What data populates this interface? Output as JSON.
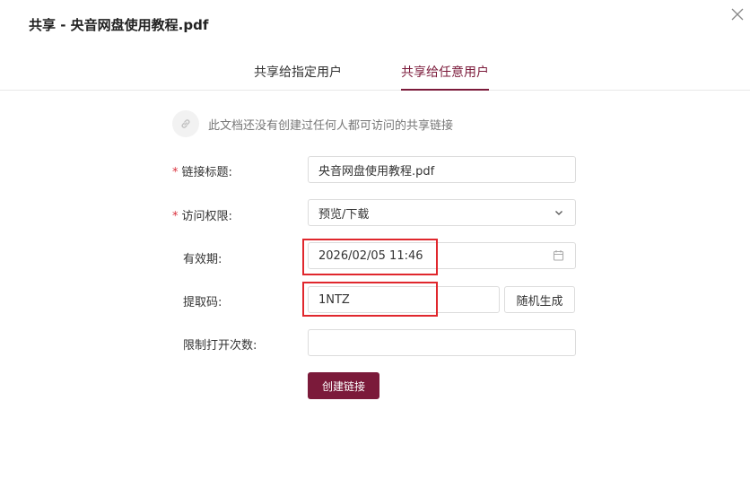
{
  "dialog": {
    "title": "共享 - 央音网盘使用教程.pdf"
  },
  "tabs": [
    {
      "label": "共享给指定用户",
      "active": false
    },
    {
      "label": "共享给任意用户",
      "active": true
    }
  ],
  "notice": {
    "text": "此文档还没有创建过任何人都可访问的共享链接",
    "icon": "link-icon"
  },
  "form": {
    "required_mark": "*",
    "link_title": {
      "label": "链接标题:",
      "value": "央音网盘使用教程.pdf"
    },
    "access": {
      "label": "访问权限:",
      "value": "预览/下载"
    },
    "expiry": {
      "label": "有效期:",
      "value": "2026/02/05 11:46"
    },
    "code": {
      "label": "提取码:",
      "value": "1NTZ",
      "random_label": "随机生成"
    },
    "limit": {
      "label": "限制打开次数:",
      "value": ""
    }
  },
  "create_button": {
    "label": "创建链接"
  },
  "colors": {
    "accent": "#7b1a3a",
    "required": "#d9303c",
    "highlight": "#e0272d"
  }
}
